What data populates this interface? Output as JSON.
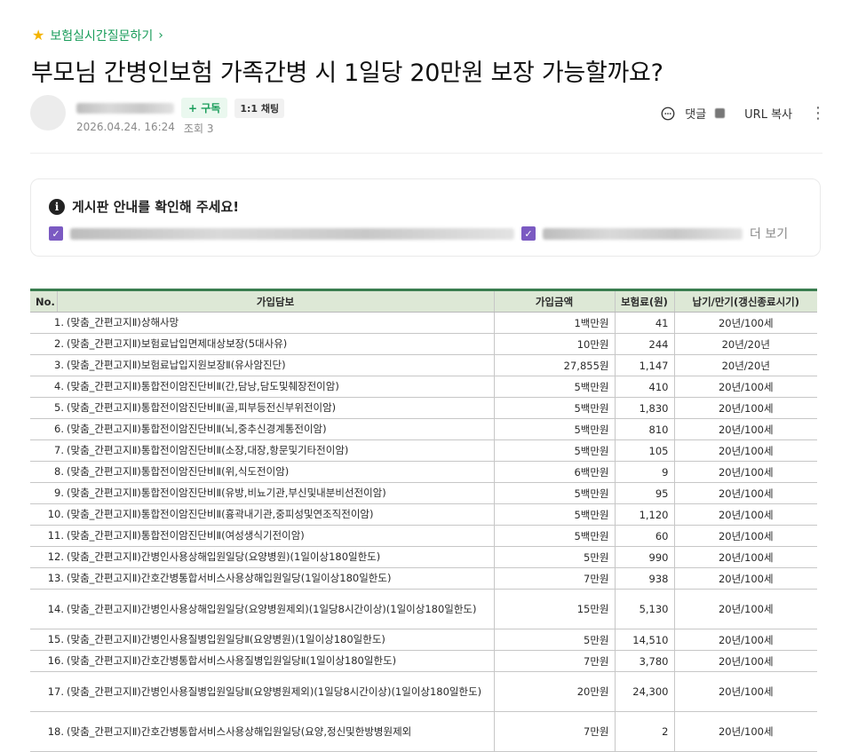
{
  "breadcrumb": {
    "label": "보험실시간질문하기"
  },
  "post": {
    "title": "부모님 간병인보험 가족간병 시 1일당 20만원 보장 가능할까요?",
    "subscribe_label": "+ 구독",
    "chat_label": "1:1 채팅",
    "date": "2026.04.24. 16:24",
    "views": "조회 3",
    "comment_label": "댓글",
    "url_copy_label": "URL 복사"
  },
  "notice": {
    "heading": "게시판 안내를 확인해 주세요!",
    "more_label": "더 보기"
  },
  "table": {
    "headers": [
      "No.",
      "가입담보",
      "가입금액",
      "보험료(원)",
      "납기/만기(갱신종료시기)"
    ],
    "rows": [
      {
        "no": "1.",
        "coverage": "(맞춤_간편고지Ⅱ)상해사망",
        "amount": "1백만원",
        "premium": "41",
        "term": "20년/100세"
      },
      {
        "no": "2.",
        "coverage": "(맞춤_간편고지Ⅱ)보험료납입면제대상보장(5대사유)",
        "amount": "10만원",
        "premium": "244",
        "term": "20년/20년"
      },
      {
        "no": "3.",
        "coverage": "(맞춤_간편고지Ⅱ)보험료납입지원보장Ⅱ(유사암진단)",
        "amount": "27,855원",
        "premium": "1,147",
        "term": "20년/20년"
      },
      {
        "no": "4.",
        "coverage": "(맞춤_간편고지Ⅱ)통합전이암진단비Ⅱ(간,담낭,담도및췌장전이암)",
        "amount": "5백만원",
        "premium": "410",
        "term": "20년/100세"
      },
      {
        "no": "5.",
        "coverage": "(맞춤_간편고지Ⅱ)통합전이암진단비Ⅱ(골,피부등전신부위전이암)",
        "amount": "5백만원",
        "premium": "1,830",
        "term": "20년/100세"
      },
      {
        "no": "6.",
        "coverage": "(맞춤_간편고지Ⅱ)통합전이암진단비Ⅱ(뇌,중추신경계통전이암)",
        "amount": "5백만원",
        "premium": "810",
        "term": "20년/100세"
      },
      {
        "no": "7.",
        "coverage": "(맞춤_간편고지Ⅱ)통합전이암진단비Ⅱ(소장,대장,항문및기타전이암)",
        "amount": "5백만원",
        "premium": "105",
        "term": "20년/100세"
      },
      {
        "no": "8.",
        "coverage": "(맞춤_간편고지Ⅱ)통합전이암진단비Ⅱ(위,식도전이암)",
        "amount": "6백만원",
        "premium": "9",
        "term": "20년/100세"
      },
      {
        "no": "9.",
        "coverage": "(맞춤_간편고지Ⅱ)통합전이암진단비Ⅱ(유방,비뇨기관,부신및내분비선전이암)",
        "amount": "5백만원",
        "premium": "95",
        "term": "20년/100세"
      },
      {
        "no": "10.",
        "coverage": "(맞춤_간편고지Ⅱ)통합전이암진단비Ⅱ(흉곽내기관,중피성및연조직전이암)",
        "amount": "5백만원",
        "premium": "1,120",
        "term": "20년/100세"
      },
      {
        "no": "11.",
        "coverage": "(맞춤_간편고지Ⅱ)통합전이암진단비Ⅱ(여성생식기전이암)",
        "amount": "5백만원",
        "premium": "60",
        "term": "20년/100세"
      },
      {
        "no": "12.",
        "coverage": "(맞춤_간편고지Ⅱ)간병인사용상해입원일당(요양병원)(1일이상180일한도)",
        "amount": "5만원",
        "premium": "990",
        "term": "20년/100세"
      },
      {
        "no": "13.",
        "coverage": "(맞춤_간편고지Ⅱ)간호간병통합서비스사용상해입원일당(1일이상180일한도)",
        "amount": "7만원",
        "premium": "938",
        "term": "20년/100세"
      },
      {
        "no": "14.",
        "coverage": "(맞춤_간편고지Ⅱ)간병인사용상해입원일당(요양병원제외)(1일당8시간이상)(1일이상180일한도)",
        "amount": "15만원",
        "premium": "5,130",
        "term": "20년/100세"
      },
      {
        "no": "15.",
        "coverage": "(맞춤_간편고지Ⅱ)간병인사용질병입원일당Ⅱ(요양병원)(1일이상180일한도)",
        "amount": "5만원",
        "premium": "14,510",
        "term": "20년/100세"
      },
      {
        "no": "16.",
        "coverage": "(맞춤_간편고지Ⅱ)간호간병통합서비스사용질병입원일당Ⅱ(1일이상180일한도)",
        "amount": "7만원",
        "premium": "3,780",
        "term": "20년/100세"
      },
      {
        "no": "17.",
        "coverage": "(맞춤_간편고지Ⅱ)간병인사용질병입원일당Ⅱ(요양병원제외)(1일당8시간이상)(1일이상180일한도)",
        "amount": "20만원",
        "premium": "24,300",
        "term": "20년/100세"
      },
      {
        "no": "18.",
        "coverage": "(맞춤_간편고지Ⅱ)간호간병통합서비스사용상해입원일당(요양,정신및한방병원제외",
        "amount": "7만원",
        "premium": "2",
        "term": "20년/100세"
      }
    ]
  }
}
